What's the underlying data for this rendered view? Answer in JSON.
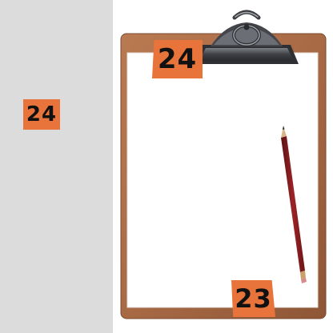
{
  "tags": {
    "left_label": "24",
    "top_label": "24",
    "bottom_label": "23"
  },
  "colors": {
    "tag_background": "#e8743b",
    "left_panel": "#dcdcdc",
    "board": "#a86a45",
    "paper": "#ffffff",
    "clip": "#4a4c50",
    "pencil": "#8a1f22"
  },
  "icons": {
    "clipboard": "clipboard-icon",
    "pencil": "pencil-icon"
  }
}
